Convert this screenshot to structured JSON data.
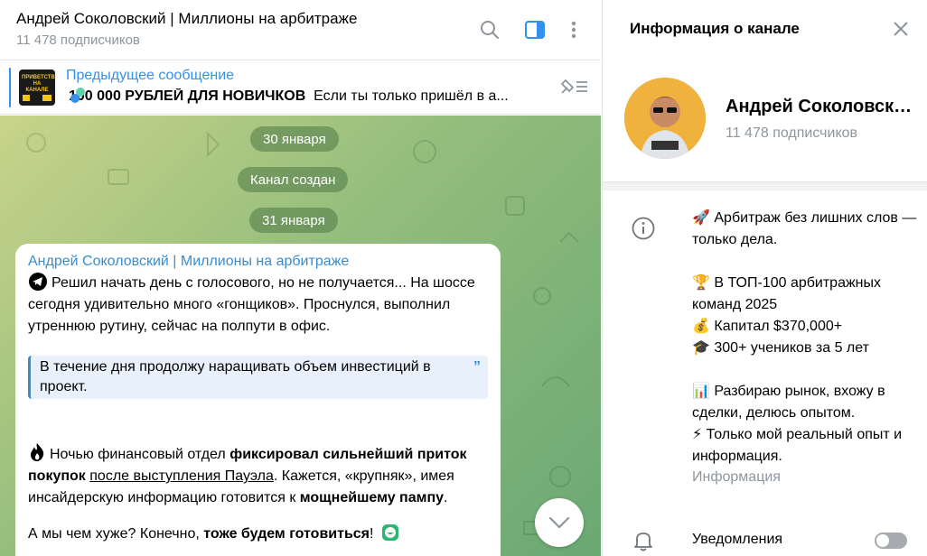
{
  "header": {
    "title": "Андрей Соколовский | Миллионы на арбитраже",
    "subtitle": "11 478 подписчиков"
  },
  "pinned": {
    "title": "Предыдущее сообщение",
    "bold": "100 000 РУБЛЕЙ ДЛЯ НОВИЧКОВ",
    "text": "Если ты только пришёл в а...",
    "thumb_text": "ПРИВЕТСТВУЮ НА КАНАЛЕ"
  },
  "dates": {
    "d1": "30 января",
    "d2": "Канал создан",
    "d3": "31 января"
  },
  "message": {
    "author": "Андрей Соколовский | Миллионы на арбитраже",
    "p1": "Решил начать день с голосового, но не получается... На шоссе сегодня удивительно много «гонщиков». Проснулся, выполнил утреннюю рутину, сейчас на полпути в офис.",
    "quote": "В течение дня продолжу наращивать объем инвестиций в проект.",
    "p2_a": "Ночью финансовый отдел ",
    "p2_b": "фиксировал сильнейший приток покупок",
    "p2_c": " ",
    "p2_d": "после выступления Пауэла",
    "p2_e": ". Кажется, «крупняк», имея инсайдерскую информацию готовится к ",
    "p2_f": "мощнейшему пампу",
    "p2_g": ".",
    "p3_a": "А мы чем хуже? Конечно, ",
    "p3_b": "тоже будем готовиться",
    "p3_c": "!"
  },
  "panel": {
    "title": "Информация о канале",
    "name": "Андрей Соколовский | Миллионы на арбитраже",
    "subscribers": "11 478 подписчиков",
    "about": {
      "l1": "🚀 Арбитраж без лишних слов — только дела.",
      "l2": "🏆 В ТОП-100 арбитражных команд 2025",
      "l3": "💰 Капитал $370,000+",
      "l4": "🎓 300+ учеников за 5 лет",
      "l5": "📊 Разбираю рынок, вхожу в сделки, делюсь опытом.",
      "l6": "⚡ Только мой реальный опыт и информация."
    },
    "about_label": "Информация",
    "notifications": "Уведомления",
    "notifications_on": false
  },
  "colors": {
    "accent": "#3390ec",
    "author": "#3a8ccf"
  }
}
